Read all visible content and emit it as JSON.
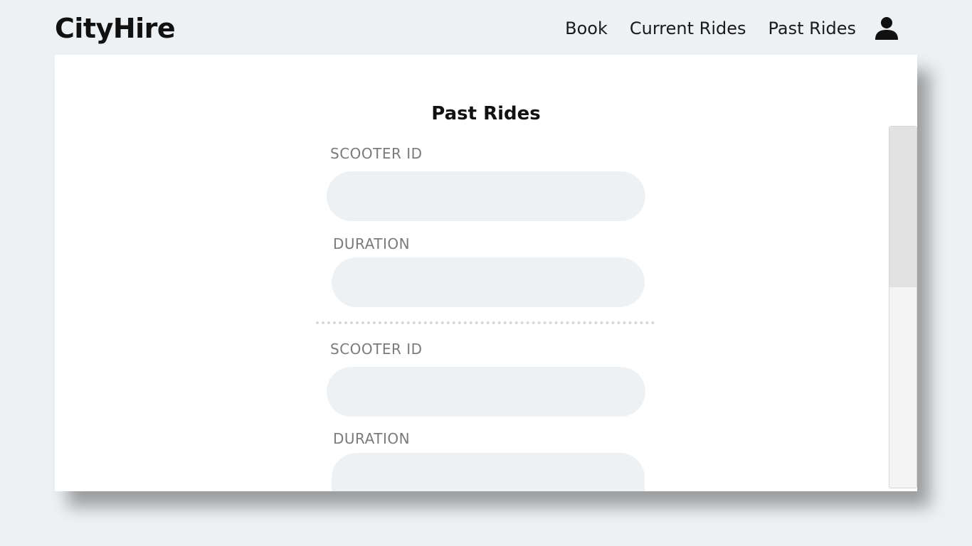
{
  "app": {
    "logo": "CityHire"
  },
  "nav": {
    "links": [
      {
        "label": "Book"
      },
      {
        "label": "Current Rides"
      },
      {
        "label": "Past Rides"
      }
    ],
    "profile_icon": "user-icon"
  },
  "main": {
    "title": "Past Rides",
    "rides": [
      {
        "scooter_id_label": "SCOOTER ID",
        "scooter_id_value": "",
        "duration_label": "DURATION",
        "duration_value": ""
      },
      {
        "scooter_id_label": "SCOOTER ID",
        "scooter_id_value": "",
        "duration_label": "DURATION",
        "duration_value": ""
      }
    ]
  },
  "colors": {
    "background": "#eef1f4",
    "panel": "#ffffff",
    "input_fill": "#eef1f4",
    "label_text": "#7a7a7a",
    "heading_text": "#111111"
  }
}
